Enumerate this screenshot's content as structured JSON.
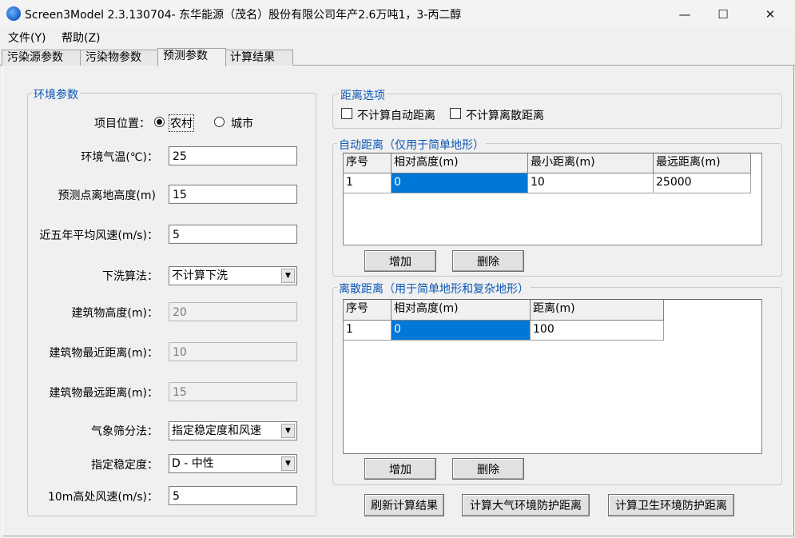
{
  "window": {
    "title": "Screen3Model 2.3.130704- 东华能源（茂名）股份有限公司年产2.6万吨1，3-丙二醇",
    "minimize": "—",
    "maximize": "☐",
    "close": "✕"
  },
  "menu": [
    "文件(Y)",
    "帮助(Z)"
  ],
  "tabs": [
    "污染源参数",
    "污染物参数",
    "预测参数",
    "计算结果"
  ],
  "env": {
    "title": "环境参数",
    "location_label": "项目位置：",
    "rural": "农村",
    "urban": "城市",
    "temp_label": "环境气温(℃)：",
    "temp_value": "25",
    "height_label": "预测点离地高度(m)",
    "height_value": "15",
    "wind5_label": "近五年平均风速(m/s)：",
    "wind5_value": "5",
    "downwash_label": "下洗算法：",
    "downwash_value": "不计算下洗",
    "bldg_h_label": "建筑物高度(m)：",
    "bldg_h_value": "20",
    "bldg_min_label": "建筑物最近距离(m)：",
    "bldg_min_value": "10",
    "bldg_max_label": "建筑物最远距离(m)：",
    "bldg_max_value": "15",
    "met_label": "气象筛分法：",
    "met_value": "指定稳定度和风速",
    "stab_label": "指定稳定度：",
    "stab_value": "D - 中性",
    "wind10_label": "10m高处风速(m/s)：",
    "wind10_value": "5"
  },
  "dist_options": {
    "title": "距离选项",
    "no_auto": "不计算自动距离",
    "no_discrete": "不计算离散距离"
  },
  "auto": {
    "title": "自动距离（仅用于简单地形）",
    "headers": [
      "序号",
      "相对高度(m)",
      "最小距离(m)",
      "最远距离(m)"
    ],
    "row": [
      "1",
      "0",
      "10",
      "25000"
    ],
    "add": "增加",
    "delete": "删除"
  },
  "discrete": {
    "title": "离散距离（用于简单地形和复杂地形）",
    "headers": [
      "序号",
      "相对高度(m)",
      "距离(m)"
    ],
    "row": [
      "1",
      "0",
      "100"
    ],
    "add": "增加",
    "delete": "删除"
  },
  "actions": {
    "refresh": "刷新计算结果",
    "atmos": "计算大气环境防护距离",
    "sanitary": "计算卫生环境防护距离"
  }
}
